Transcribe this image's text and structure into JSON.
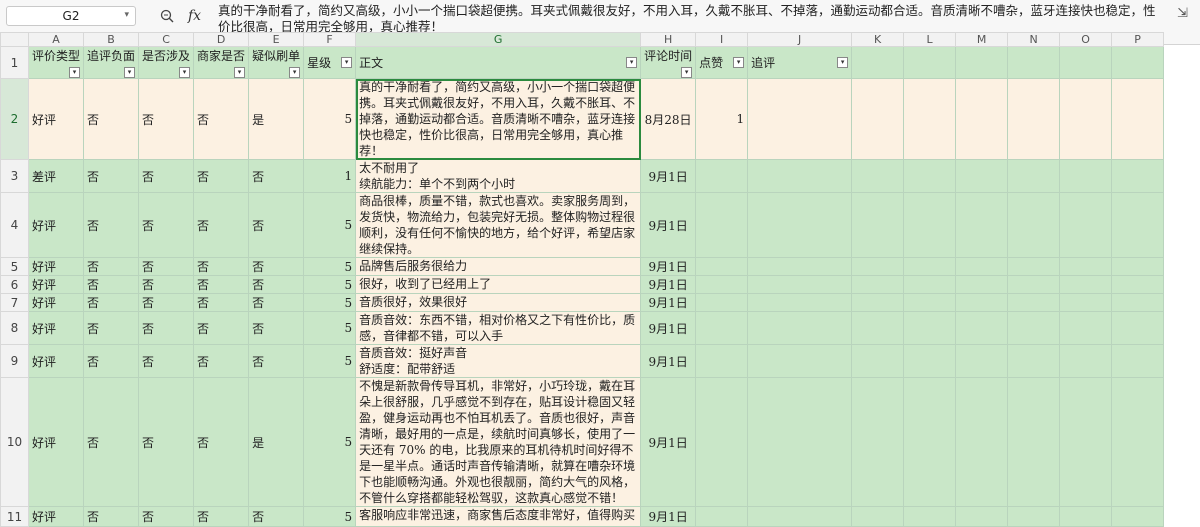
{
  "formula_bar": {
    "cell_ref": "G2",
    "content": "真的干净耐看了，简约又高级，小小一个揣口袋超便携。耳夹式佩戴很友好，不用入耳，久戴不胀耳、不掉落，通勤运动都合适。音质清晰不嘈杂，蓝牙连接快也稳定，性价比很高，日常用完全够用，真心推荐！"
  },
  "columns": [
    "A",
    "B",
    "C",
    "D",
    "E",
    "F",
    "G",
    "H",
    "I",
    "J",
    "K",
    "L",
    "M",
    "N",
    "O",
    "P"
  ],
  "headers": [
    "评价类型",
    "追评负面",
    "是否涉及",
    "商家是否",
    "疑似刷单",
    "星级",
    "正文",
    "评论时间",
    "点赞",
    "追评",
    "",
    "",
    "",
    "",
    "",
    ""
  ],
  "rows": [
    {
      "n": "2",
      "a": "好评",
      "b": "否",
      "c": "否",
      "d": "否",
      "e": "是",
      "f": "5",
      "g": "真的干净耐看了，简约又高级，小小一个揣口袋超便携。耳夹式佩戴很友好，不用入耳，久戴不胀耳、不掉落，通勤运动都合适。音质清晰不嘈杂，蓝牙连接快也稳定，性价比很高，日常用完全够用，真心推荐！",
      "h": "8月28日",
      "i": "1"
    },
    {
      "n": "3",
      "a": "差评",
      "b": "否",
      "c": "否",
      "d": "否",
      "e": "否",
      "f": "1",
      "g": "太不耐用了\n续航能力：单个不到两个小时",
      "h": "9月1日",
      "i": ""
    },
    {
      "n": "4",
      "a": "好评",
      "b": "否",
      "c": "否",
      "d": "否",
      "e": "否",
      "f": "5",
      "g": "商品很棒，质量不错，款式也喜欢。卖家服务周到，发货快，物流给力，包装完好无损。整体购物过程很顺利，没有任何不愉快的地方，给个好评，希望店家继续保持。",
      "h": "9月1日",
      "i": ""
    },
    {
      "n": "5",
      "a": "好评",
      "b": "否",
      "c": "否",
      "d": "否",
      "e": "否",
      "f": "5",
      "g": "品牌售后服务很给力",
      "h": "9月1日",
      "i": ""
    },
    {
      "n": "6",
      "a": "好评",
      "b": "否",
      "c": "否",
      "d": "否",
      "e": "否",
      "f": "5",
      "g": "很好，收到了已经用上了",
      "h": "9月1日",
      "i": ""
    },
    {
      "n": "7",
      "a": "好评",
      "b": "否",
      "c": "否",
      "d": "否",
      "e": "否",
      "f": "5",
      "g": "音质很好，效果很好",
      "h": "9月1日",
      "i": ""
    },
    {
      "n": "8",
      "a": "好评",
      "b": "否",
      "c": "否",
      "d": "否",
      "e": "否",
      "f": "5",
      "g": "音质音效：东西不错，相对价格又之下有性价比，质感，音律都不错，可以入手",
      "h": "9月1日",
      "i": ""
    },
    {
      "n": "9",
      "a": "好评",
      "b": "否",
      "c": "否",
      "d": "否",
      "e": "否",
      "f": "5",
      "g": "音质音效：挺好声音\n舒适度：配带舒适",
      "h": "9月1日",
      "i": ""
    },
    {
      "n": "10",
      "a": "好评",
      "b": "否",
      "c": "否",
      "d": "否",
      "e": "是",
      "f": "5",
      "g": "不愧是新款骨传导耳机，非常好，小巧玲珑，戴在耳朵上很舒服，几乎感觉不到存在，贴耳设计稳固又轻盈，健身运动再也不怕耳机丢了。音质也很好，声音清晰，最好用的一点是，续航时间真够长，使用了一天还有 70% 的电，比我原来的耳机待机时间好得不是一星半点。通话时声音传输清晰，就算在嘈杂环境下也能顺畅沟通。外观也很靓丽，简约大气的风格，不管什么穿搭都能轻松驾驭，这款真心感觉不错！",
      "h": "9月1日",
      "i": ""
    },
    {
      "n": "11",
      "a": "好评",
      "b": "否",
      "c": "否",
      "d": "否",
      "e": "否",
      "f": "5",
      "g": "客服响应非常迅速，商家售后态度非常好，值得购买",
      "h": "9月1日",
      "i": ""
    }
  ]
}
